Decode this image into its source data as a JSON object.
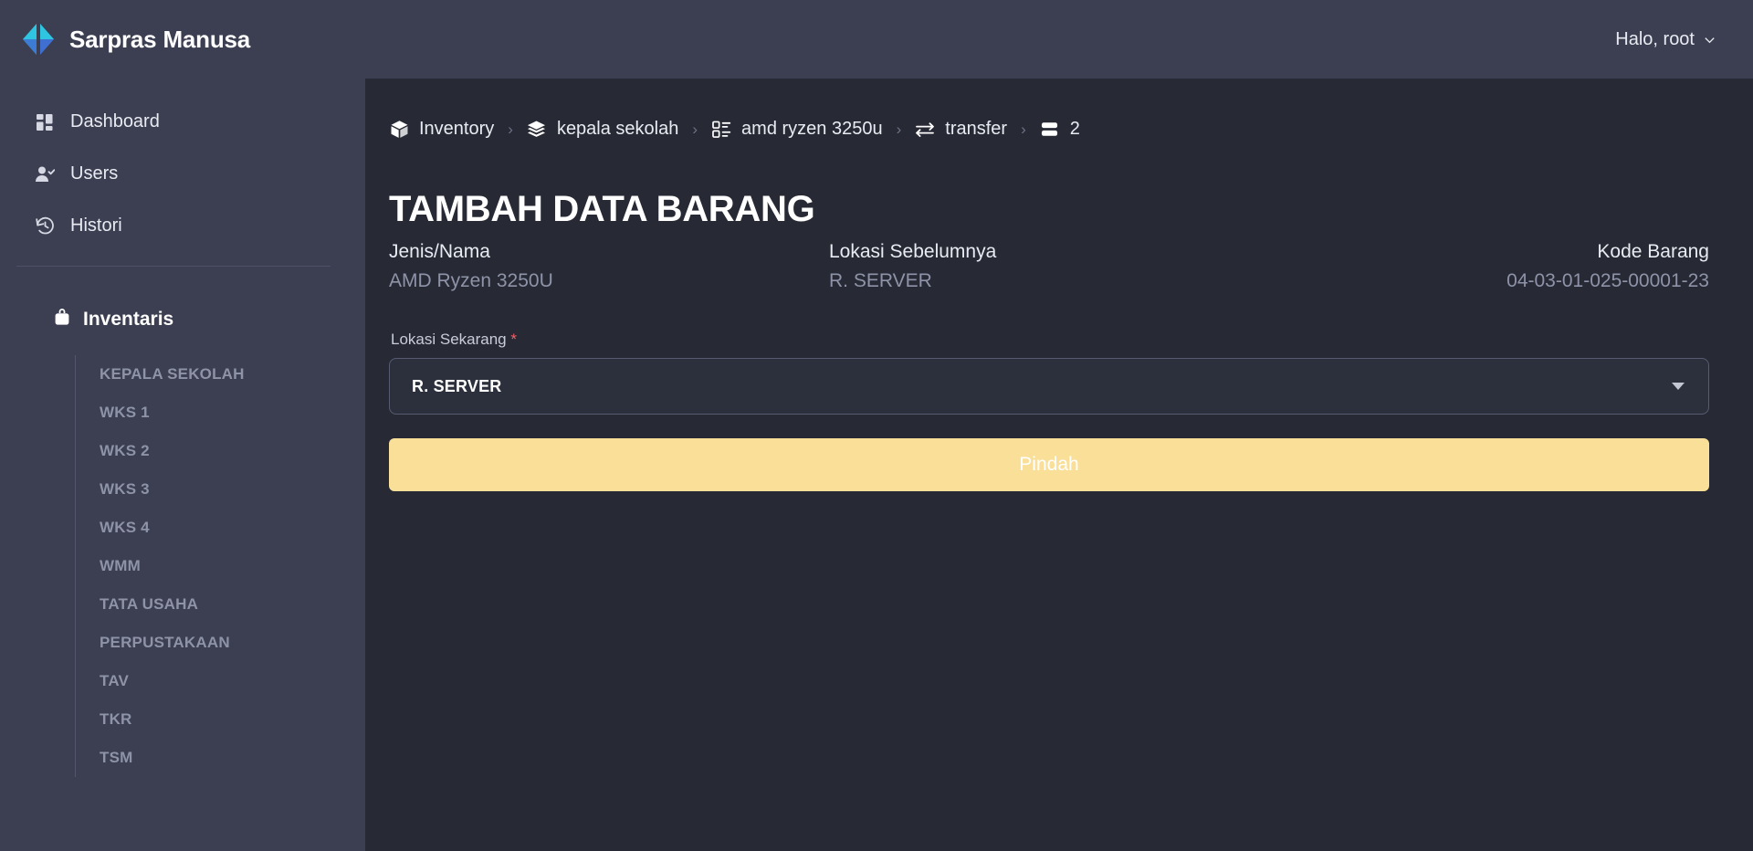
{
  "header": {
    "brand_name": "Sarpras Manusa",
    "logo_icon": "code-brackets-logo",
    "user_greeting": "Halo, root",
    "user_chevron_icon": "chevron-down-icon"
  },
  "sidebar": {
    "nav": [
      {
        "label": "Dashboard",
        "icon": "grid-dashboard-icon"
      },
      {
        "label": "Users",
        "icon": "user-check-icon"
      },
      {
        "label": "Histori",
        "icon": "clock-rewind-icon"
      }
    ],
    "section": {
      "label": "Inventaris",
      "icon": "bag-icon",
      "items": [
        {
          "label": "KEPALA SEKOLAH"
        },
        {
          "label": "WKS 1"
        },
        {
          "label": "WKS 2"
        },
        {
          "label": "WKS 3"
        },
        {
          "label": "WKS 4"
        },
        {
          "label": "WMM"
        },
        {
          "label": "TATA USAHA"
        },
        {
          "label": "PERPUSTAKAAN"
        },
        {
          "label": "TAV"
        },
        {
          "label": "TKR"
        },
        {
          "label": "TSM"
        }
      ]
    }
  },
  "breadcrumb": {
    "separator": "›",
    "items": [
      {
        "label": "Inventory",
        "icon": "box-3d-icon"
      },
      {
        "label": "kepala sekolah",
        "icon": "layers-stack-icon"
      },
      {
        "label": "amd ryzen 3250u",
        "icon": "list-detail-icon"
      },
      {
        "label": "transfer",
        "icon": "transfer-arrows-icon"
      },
      {
        "label": "2",
        "icon": "rows-icon"
      }
    ]
  },
  "main": {
    "page_title": "TAMBAH DATA BARANG",
    "info": [
      {
        "label": "Jenis/Nama",
        "value": "AMD Ryzen 3250U"
      },
      {
        "label": "Lokasi Sebelumnya",
        "value": "R. SERVER"
      },
      {
        "label": "Kode Barang",
        "value": "04-03-01-025-00001-23"
      }
    ],
    "form": {
      "location_label": "Lokasi Sekarang",
      "required_mark": "*",
      "location_value": "R. SERVER",
      "dropdown_icon": "chevron-down-icon",
      "submit_label": "Pindah"
    }
  },
  "colors": {
    "panel": "#3b3f51",
    "content": "#272a35",
    "accent_button": "#fadf99",
    "logo_cyan": "#2fc5e0",
    "logo_blue": "#3f6fd1",
    "required_red": "#f2606a",
    "muted_text": "#8e93a8"
  }
}
